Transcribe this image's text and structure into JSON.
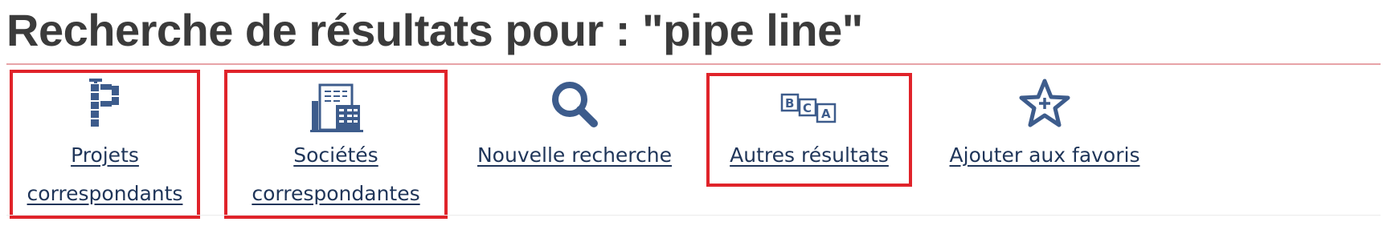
{
  "header": {
    "title": "Recherche de résultats pour : \"pipe line\""
  },
  "actions": [
    {
      "id": "projets",
      "label_line1": "Projets",
      "label_line2": "correspondants",
      "icon": "pipe-p-icon",
      "highlighted": true
    },
    {
      "id": "societes",
      "label_line1": "Sociétés",
      "label_line2": "correspondantes",
      "icon": "building-icon",
      "highlighted": true
    },
    {
      "id": "nouvelle",
      "label": "Nouvelle recherche",
      "icon": "search-icon",
      "highlighted": false
    },
    {
      "id": "autres",
      "label": "Autres résultats",
      "icon": "bca-blocks-icon",
      "highlighted": true
    },
    {
      "id": "favoris",
      "label": "Ajouter aux favoris",
      "icon": "star-plus-icon",
      "highlighted": false
    }
  ],
  "colors": {
    "icon": "#3d5c8c",
    "link": "#1f3559",
    "highlight": "#e0232a",
    "title": "#3b3b3b",
    "rule": "#e7a3a7"
  }
}
